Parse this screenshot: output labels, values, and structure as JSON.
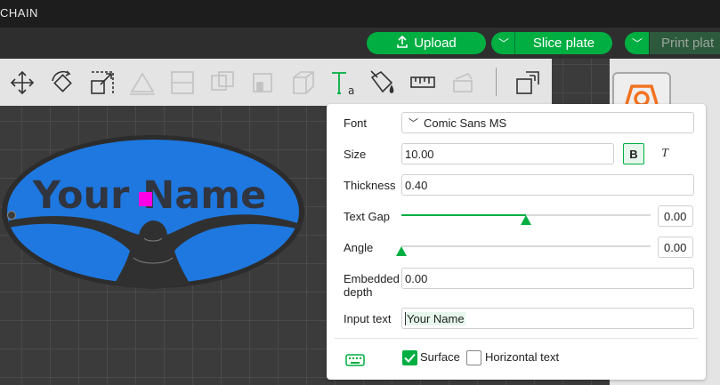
{
  "window": {
    "title": "CHAIN"
  },
  "actions": {
    "upload_label": "Upload",
    "slice_label": "Slice plate",
    "print_label": "Print plat",
    "dropdown_glyph": "﹀"
  },
  "toolbar": {
    "tools": [
      {
        "name": "move-icon",
        "enabled": true
      },
      {
        "name": "rotate-icon",
        "enabled": true
      },
      {
        "name": "scale-icon",
        "enabled": true
      },
      {
        "name": "lay-on-face-icon",
        "enabled": false
      },
      {
        "name": "cut-icon",
        "enabled": false
      },
      {
        "name": "mesh-boolean-icon",
        "enabled": false
      },
      {
        "name": "support-paint-icon",
        "enabled": false
      },
      {
        "name": "seam-paint-icon",
        "enabled": false
      },
      {
        "name": "text-icon",
        "enabled": true,
        "active": true
      },
      {
        "name": "color-paint-icon",
        "enabled": true
      },
      {
        "name": "measure-icon",
        "enabled": true
      },
      {
        "name": "assembly-icon",
        "enabled": false
      },
      {
        "name": "arrange-icon",
        "enabled": true
      }
    ]
  },
  "model": {
    "text": "Your Name",
    "fill_color": "#1e78e0",
    "text_color": "#303540"
  },
  "text_panel": {
    "font_label": "Font",
    "font_value": "Comic Sans MS",
    "size_label": "Size",
    "size_value": "10.00",
    "bold_label": "B",
    "italic_label": "T",
    "thickness_label": "Thickness",
    "thickness_value": "0.40",
    "text_gap_label": "Text Gap",
    "text_gap_value": "0.00",
    "text_gap_slider": 0.5,
    "angle_label": "Angle",
    "angle_value": "0.00",
    "angle_slider": 0.0,
    "embedded_depth_label_1": "Embedded",
    "embedded_depth_label_2": "depth",
    "embedded_depth_value": "0.00",
    "input_text_label": "Input text",
    "input_text_value": "Your Name",
    "surface_label": "Surface",
    "surface_checked": true,
    "horizontal_label": "Horizontal text",
    "horizontal_checked": false
  },
  "colors": {
    "accent": "#00ae42"
  }
}
